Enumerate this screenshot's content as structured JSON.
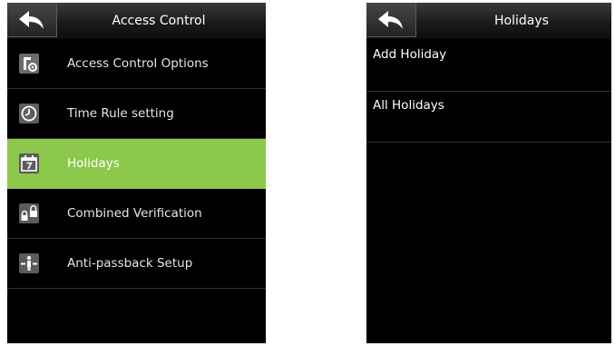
{
  "left_screen": {
    "title": "Access Control",
    "back_icon": "back-arrow-icon",
    "menu": [
      {
        "label": "Access Control Options",
        "icon": "access-control-options-icon",
        "active": false
      },
      {
        "label": "Time Rule setting",
        "icon": "clock-icon",
        "active": false
      },
      {
        "label": "Holidays",
        "icon": "calendar-icon",
        "active": true
      },
      {
        "label": "Combined Verification",
        "icon": "combined-verification-icon",
        "active": false
      },
      {
        "label": "Anti-passback Setup",
        "icon": "anti-passback-icon",
        "active": false
      }
    ],
    "active_color": "#8cc84b"
  },
  "right_screen": {
    "title": "Holidays",
    "back_icon": "back-arrow-icon",
    "items": [
      {
        "label": "Add Holiday"
      },
      {
        "label": "All Holidays"
      }
    ]
  }
}
